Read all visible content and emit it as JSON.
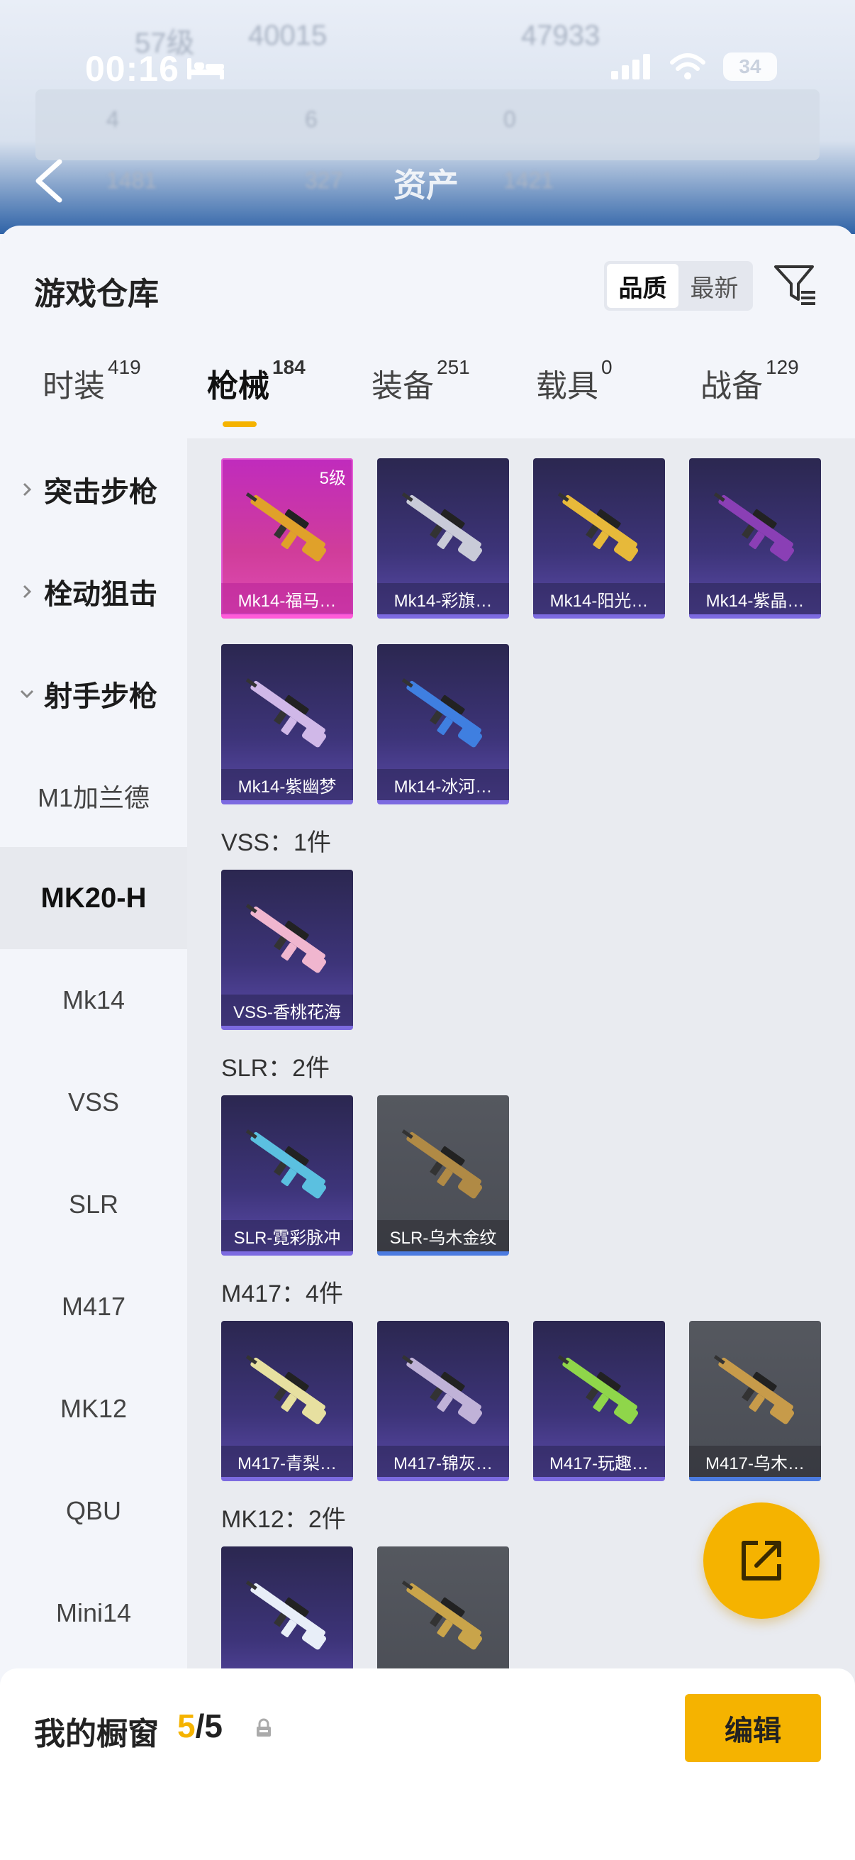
{
  "status_bar": {
    "time": "00:16",
    "battery": "34"
  },
  "header": {
    "title": "资产",
    "blurred": {
      "level": "57级",
      "coins": "40015",
      "value2": "47933",
      "r1a": "4",
      "r1b": "6",
      "r1c": "0",
      "r2a": "1481",
      "r2b": "327",
      "r2c": "1421"
    }
  },
  "warehouse": {
    "title": "游戏仓库",
    "sort_options": [
      "品质",
      "最新"
    ],
    "active_sort": "品质",
    "tabs": [
      {
        "label": "时装",
        "count": "419"
      },
      {
        "label": "枪械",
        "count": "184"
      },
      {
        "label": "装备",
        "count": "251"
      },
      {
        "label": "载具",
        "count": "0"
      },
      {
        "label": "战备",
        "count": "129"
      }
    ],
    "active_tab": "枪械"
  },
  "sidebar": {
    "categories": [
      {
        "label": "突击步枪",
        "expanded": false
      },
      {
        "label": "栓动狙击",
        "expanded": false
      },
      {
        "label": "射手步枪",
        "expanded": true
      }
    ],
    "subitems": [
      "M1加兰德",
      "MK20-H",
      "Mk14",
      "VSS",
      "SLR",
      "M417",
      "MK12",
      "QBU",
      "Mini14"
    ],
    "active_subitem": "MK20-H"
  },
  "grid": {
    "mk14_items": [
      {
        "name": "Mk14-福马…",
        "level": "5级",
        "rarity": "pink",
        "color": "#e0a12a"
      },
      {
        "name": "Mk14-彩旗…",
        "rarity": "purple",
        "color": "#c9cbd8"
      },
      {
        "name": "Mk14-阳光…",
        "rarity": "purple",
        "color": "#e7b93a"
      },
      {
        "name": "Mk14-紫晶…",
        "rarity": "purple",
        "color": "#8a3fb5"
      },
      {
        "name": "Mk14-紫幽梦",
        "rarity": "purple",
        "color": "#d0b8e8"
      },
      {
        "name": "Mk14-冰河…",
        "rarity": "purple",
        "color": "#3f7fe0"
      }
    ],
    "sections": [
      {
        "title": "VSS：1件",
        "items": [
          {
            "name": "VSS-香桃花海",
            "rarity": "purple",
            "color": "#f0b6cf"
          }
        ]
      },
      {
        "title": "SLR：2件",
        "items": [
          {
            "name": "SLR-霓彩脉冲",
            "rarity": "purple",
            "color": "#5bc0e0"
          },
          {
            "name": "SLR-乌木金纹",
            "rarity": "gray",
            "color": "#b08a45"
          }
        ]
      },
      {
        "title": "M417：4件",
        "items": [
          {
            "name": "M417-青梨…",
            "rarity": "purple",
            "color": "#e7e0a0"
          },
          {
            "name": "M417-锦灰…",
            "rarity": "purple",
            "color": "#c0b2d8"
          },
          {
            "name": "M417-玩趣…",
            "rarity": "purple",
            "color": "#8fd64a"
          },
          {
            "name": "M417-乌木…",
            "rarity": "gray",
            "color": "#c79b4a"
          }
        ]
      },
      {
        "title": "MK12：2件",
        "items": [
          {
            "name": "",
            "rarity": "purple",
            "color": "#e8eef8"
          },
          {
            "name": "",
            "rarity": "gray",
            "color": "#c9a44a"
          }
        ]
      }
    ]
  },
  "showcase": {
    "title": "我的橱窗",
    "current": "5",
    "total": "/5",
    "edit_label": "编辑"
  },
  "colors": {
    "accent": "#f5b300",
    "rarity_purple": "#7c6ae0",
    "rarity_pink": "#ff5bd9",
    "rarity_gray": "#4c7be0"
  },
  "icons": [
    "back-arrow-icon",
    "filter-icon",
    "chevron-right-icon",
    "chevron-down-icon",
    "gun-icon",
    "share-icon",
    "lock-icon",
    "wifi-icon",
    "signal-icon",
    "bed-icon"
  ]
}
